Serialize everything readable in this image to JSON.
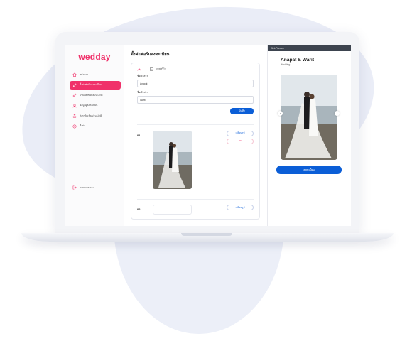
{
  "brand": {
    "logo": "wedday",
    "accent": "#f0316a",
    "primary": "#0b5ed7"
  },
  "sidebar": {
    "items": [
      {
        "label": "หน้าแรก",
        "icon": "home-icon",
        "active": false
      },
      {
        "label": "ตั้งค่าฟอร์มลงทะเบียน",
        "icon": "edit-icon",
        "active": true
      },
      {
        "label": "ปรับแต่งข้อมูลบน LINE",
        "icon": "link-icon",
        "active": false
      },
      {
        "label": "ข้อมูลผู้ลงทะเบียน",
        "icon": "users-icon",
        "active": false
      },
      {
        "label": "ส่งการ์ดเชิญผ่าน LINE",
        "icon": "share-icon",
        "active": false
      },
      {
        "label": "ตั้งค่า",
        "icon": "gear-icon",
        "active": false
      }
    ],
    "logout": "ออกจากระบบ"
  },
  "main": {
    "title": "ตั้งค่าฟอร์มลงทะเบียน",
    "card": {
      "section_label": "ภาพพรีวิว",
      "groom_label": "ชื่อเจ้าสาว",
      "groom_value": "Anapat",
      "bride_label": "ชื่อเจ้าบ่าว",
      "bride_value": "Warit",
      "save_label": "บันทึก"
    },
    "photos": [
      {
        "num": "01",
        "edit_label": "เปลี่ยนรูป",
        "delete_label": "ลบ"
      },
      {
        "num": "02",
        "edit_label": "เปลี่ยนรูป"
      }
    ]
  },
  "preview": {
    "bar_label": "Web Preview",
    "couple": "Anapat & Warit",
    "subtitle": "Wedding",
    "register_label": "ลงทะเบียน"
  }
}
